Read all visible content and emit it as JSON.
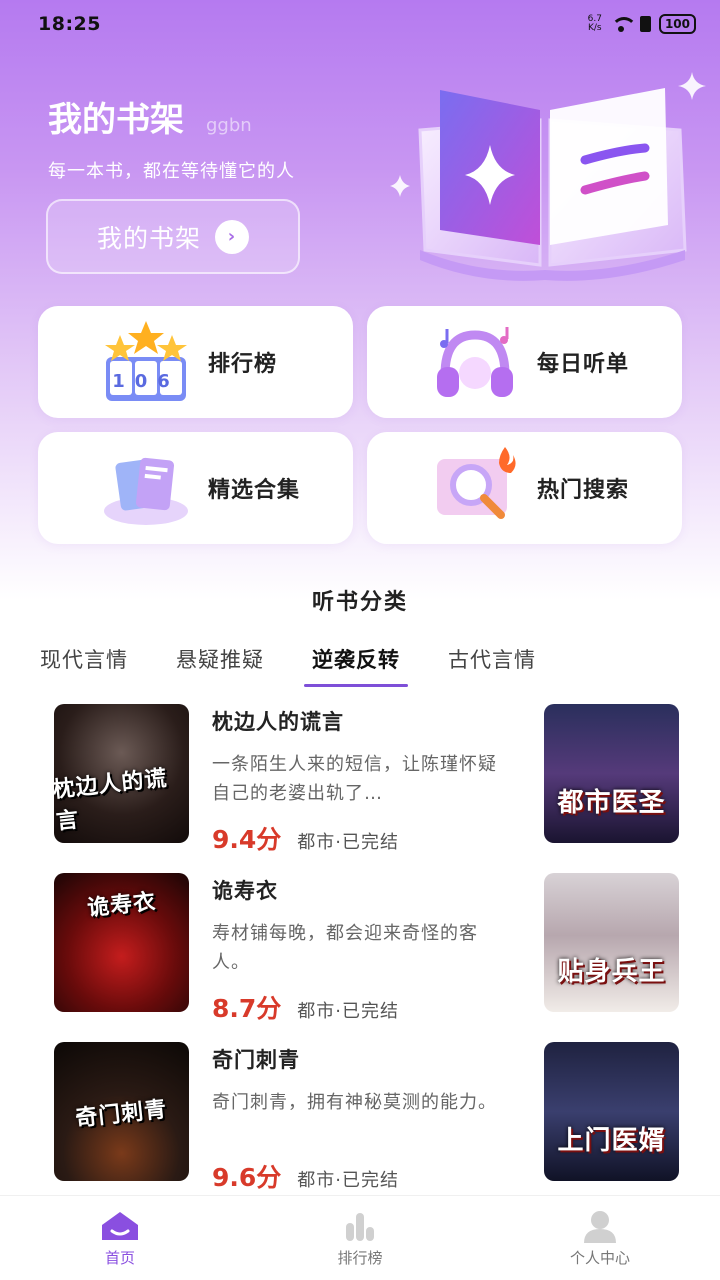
{
  "status_bar": {
    "time": "18:25",
    "net_speed_value": "6.7",
    "net_speed_unit": "K/s",
    "battery": "100"
  },
  "hero": {
    "title": "我的书架",
    "username": "ggbn",
    "subtitle": "每一本书，都在等待懂它的人",
    "button_label": "我的书架"
  },
  "quick_links": [
    {
      "label": "排行榜",
      "icon": "ranking-trophy-icon"
    },
    {
      "label": "每日听单",
      "icon": "headphones-icon"
    },
    {
      "label": "精选合集",
      "icon": "books-collection-icon"
    },
    {
      "label": "热门搜索",
      "icon": "hot-search-icon"
    }
  ],
  "rank_icon_digits": "106",
  "categories": {
    "title": "听书分类",
    "tabs": [
      {
        "label": "现代言情",
        "active": false
      },
      {
        "label": "悬疑推疑",
        "active": false
      },
      {
        "label": "逆袭反转",
        "active": true
      },
      {
        "label": "古代言情",
        "active": false
      }
    ]
  },
  "books": [
    {
      "title": "枕边人的谎言",
      "description": "一条陌生人来的短信，让陈瑾怀疑自己的老婆出轨了…",
      "score": "9.4分",
      "tags": "都市·已完结",
      "cover_title": "枕边人的谎言",
      "side_cover_title": "都市医圣"
    },
    {
      "title": "诡寿衣",
      "description": "寿材铺每晚，都会迎来奇怪的客人。",
      "score": "8.7分",
      "tags": "都市·已完结",
      "cover_title": "诡寿衣",
      "side_cover_title": "贴身兵王"
    },
    {
      "title": "奇门刺青",
      "description": "奇门刺青，拥有神秘莫测的能力。",
      "score": "9.6分",
      "tags": "都市·已完结",
      "cover_title": "奇门刺青",
      "side_cover_title": "上门医婿"
    }
  ],
  "bottom_nav": [
    {
      "label": "首页",
      "icon": "home-icon",
      "active": true
    },
    {
      "label": "排行榜",
      "icon": "bar-chart-icon",
      "active": false
    },
    {
      "label": "个人中心",
      "icon": "user-icon",
      "active": false
    }
  ],
  "colors": {
    "accent": "#8a4fe0",
    "score": "#d83a2a",
    "hero_gradient_top": "#b57af0"
  }
}
